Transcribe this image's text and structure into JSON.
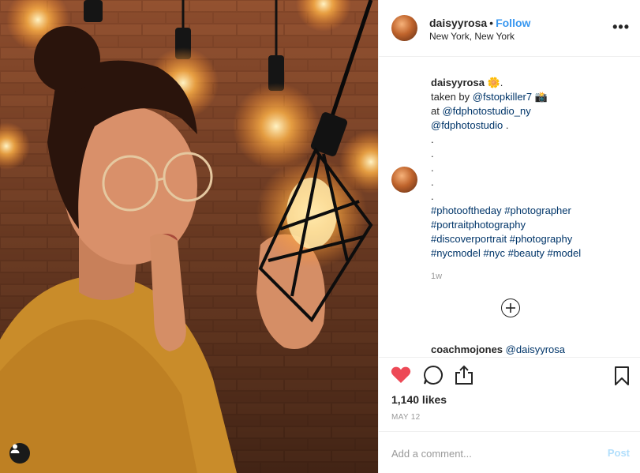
{
  "post": {
    "username": "daisyyrosa",
    "follow_label": "Follow",
    "separator": "•",
    "location": "New York, New York",
    "more_label": "•••"
  },
  "caption": {
    "username": "daisyyrosa",
    "emoji1": "🌼.",
    "taken_by": "taken by",
    "photographer": "@fstopkiller7",
    "emoji2": "📸",
    "at": "at",
    "studio1": "@fdphotostudio_ny",
    "studio2": "@fdphotostudio",
    "studio2_tail": ".",
    "dot": ".",
    "hashtags": [
      "#photooftheday",
      "#photographer",
      "#portraitphotography",
      "#discoverportrait",
      "#photography",
      "#nycmodel",
      "#nyc",
      "#beauty",
      "#model"
    ]
  },
  "time_ago": "1w",
  "comment": {
    "username": "coachmojones",
    "mention": "@daisyyrosa"
  },
  "stats": {
    "likes": "1,140 likes",
    "date": "MAY 12"
  },
  "composer": {
    "placeholder": "Add a comment...",
    "post_label": "Post"
  },
  "colors": {
    "like_red": "#ed4956",
    "link_blue": "#003569",
    "follow_blue": "#3897f0",
    "post_disabled": "#b2dffc"
  },
  "icons": [
    "heart-icon",
    "comment-icon",
    "share-icon",
    "bookmark-icon",
    "plus-circle-icon",
    "user-tag-icon",
    "more-icon"
  ]
}
